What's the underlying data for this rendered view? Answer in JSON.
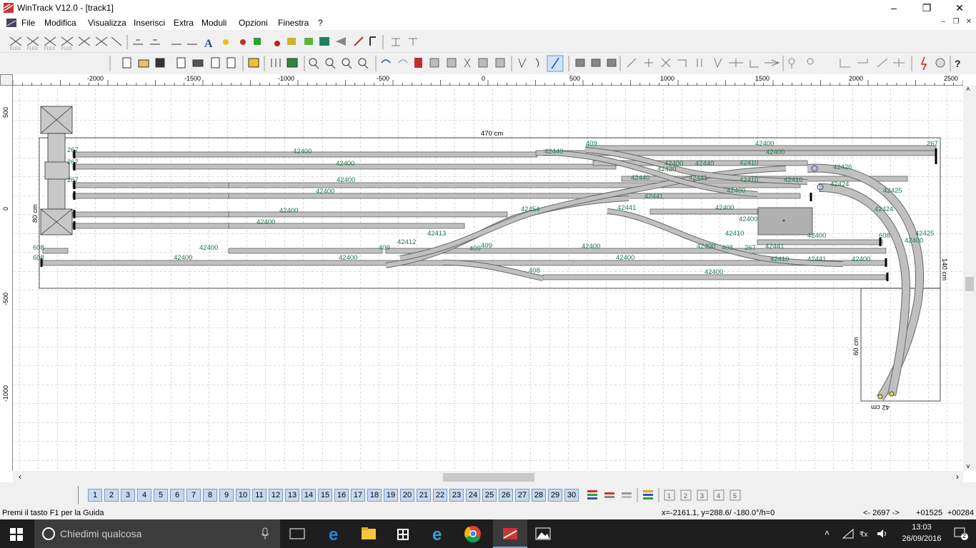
{
  "window": {
    "title": "WinTrack  V12.0 - [track1]",
    "minimize": "–",
    "maximize": "❐",
    "close": "✕"
  },
  "menu": {
    "items": [
      "File",
      "Modifica",
      "Visualizza",
      "Inserisci",
      "Extra",
      "Moduli",
      "Opzioni",
      "Finestra",
      "?"
    ]
  },
  "ruler": {
    "h_labels": [
      "-2000",
      "-1500",
      "-1000",
      "-500",
      "0",
      "500",
      "1000",
      "1500",
      "2000",
      "2500"
    ],
    "v_labels": [
      "500",
      "0",
      "-500",
      "-1000"
    ]
  },
  "layout": {
    "dim_width": "470 cm",
    "dim_depth": "80 cm",
    "dim_right": "140 cm",
    "dim_bottom_depth": "60 cm",
    "dim_bottom_width": "42 cm",
    "track_labels": [
      "42400",
      "42400",
      "42400",
      "42400",
      "42400",
      "42400",
      "42400",
      "42400",
      "42400",
      "42400",
      "42400",
      "42400",
      "42400",
      "42400",
      "42400",
      "42400",
      "42400",
      "42400",
      "42400",
      "42400",
      "42440",
      "42410",
      "42410",
      "42410",
      "42426",
      "42424",
      "42425",
      "42424",
      "42425",
      "42400",
      "42441",
      "42441",
      "42410",
      "42412",
      "42413",
      "42441",
      "42420",
      "42454",
      "42440",
      "42400",
      "42441",
      "42440",
      "42410",
      "42441",
      "409",
      "409",
      "409",
      "409",
      "408",
      "408",
      "267",
      "267",
      "267",
      "267",
      "267",
      "608",
      "608",
      "608"
    ],
    "end_labels": [
      "267",
      "267",
      "267",
      "267",
      "608",
      "608",
      "608",
      "608",
      "267",
      "267",
      "267"
    ]
  },
  "layers": [
    "1",
    "2",
    "3",
    "4",
    "5",
    "6",
    "7",
    "8",
    "9",
    "10",
    "11",
    "12",
    "13",
    "14",
    "15",
    "16",
    "17",
    "18",
    "19",
    "20",
    "21",
    "22",
    "23",
    "24",
    "25",
    "26",
    "27",
    "28",
    "29",
    "30"
  ],
  "status": {
    "help": "Premi il tasto F1 per la Guida",
    "coords": "x=-2161.1, y=288.6/ -180.0°/h=0",
    "zoom": "<- 2697 ->",
    "val1": "+01525",
    "val2": "+00284"
  },
  "taskbar": {
    "search_placeholder": "Chiedimi qualcosa",
    "time": "13:03",
    "date": "26/09/2016",
    "notifications": "2"
  },
  "colors": {
    "track": "#c0c0c0",
    "track_border": "#555555",
    "label": "#1a7a4a",
    "grid": "#9a9a9a"
  }
}
